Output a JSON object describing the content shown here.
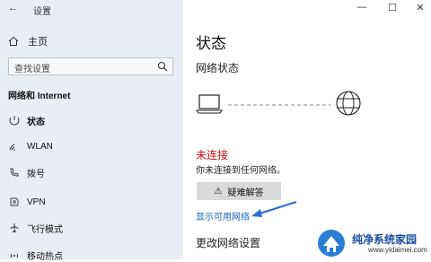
{
  "window": {
    "title": "设置",
    "controls": {
      "minimize": "—",
      "maximize": "☐",
      "close": "✕"
    }
  },
  "sidebar": {
    "home_label": "主页",
    "search_placeholder": "查找设置",
    "section_title": "网络和 Internet",
    "items": [
      {
        "label": "状态",
        "icon": "status-icon",
        "active": true
      },
      {
        "label": "WLAN",
        "icon": "wifi-icon",
        "active": false
      },
      {
        "label": "拨号",
        "icon": "dialup-icon",
        "active": false
      },
      {
        "label": "VPN",
        "icon": "vpn-icon",
        "active": false
      },
      {
        "label": "飞行模式",
        "icon": "airplane-icon",
        "active": false
      },
      {
        "label": "移动热点",
        "icon": "hotspot-icon",
        "active": false
      }
    ]
  },
  "main": {
    "title": "状态",
    "network_status_heading": "网络状态",
    "status": "未连接",
    "status_description": "你未连接到任何网络。",
    "troubleshoot_label": "疑难解答",
    "show_networks_link": "显示可用网络",
    "change_settings_heading": "更改网络设置"
  },
  "colors": {
    "sidebar_bg": "#e9eef4",
    "status_red": "#c81010",
    "link_blue": "#1565c0",
    "arrow_blue": "#2a6fd0"
  },
  "watermark": {
    "title": "纯净系统家园",
    "url": "www.yidaimei.com"
  }
}
